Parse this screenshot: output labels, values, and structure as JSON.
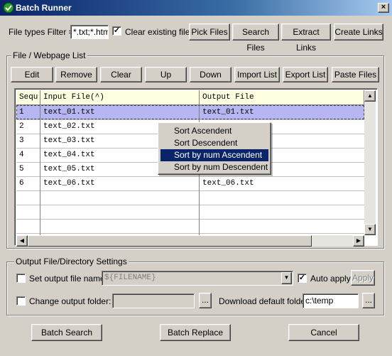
{
  "window": {
    "title": "Batch Runner"
  },
  "toolbar": {
    "filter_label": "File types Filter =>",
    "filter_value": "*.txt;*.html",
    "clear_label": "Clear existing files",
    "clear_checked": "✓",
    "pick_files": "Pick Files",
    "search_files": "Search Files",
    "extract_links": "Extract Links",
    "create_links": "Create Links"
  },
  "list_group": {
    "title": "File / Webpage List",
    "buttons": {
      "edit": "Edit",
      "remove": "Remove",
      "clear": "Clear",
      "up": "Up",
      "down": "Down",
      "import": "Import List",
      "export": "Export List",
      "paste": "Paste Files"
    },
    "columns": [
      "Sequ",
      "Input File(^)",
      "Output File"
    ],
    "rows": [
      {
        "seq": "1",
        "input": "text_01.txt",
        "output": "text_01.txt"
      },
      {
        "seq": "2",
        "input": "text_02.txt",
        "output": ""
      },
      {
        "seq": "3",
        "input": "text_03.txt",
        "output": ""
      },
      {
        "seq": "4",
        "input": "text_04.txt",
        "output": ""
      },
      {
        "seq": "5",
        "input": "text_05.txt",
        "output": ""
      },
      {
        "seq": "6",
        "input": "text_06.txt",
        "output": "text_06.txt"
      }
    ]
  },
  "context_menu": {
    "items": [
      "Sort Ascendent",
      "Sort Descendent",
      "Sort by num Ascendent",
      "Sort by num Descendent"
    ],
    "selected_index": 2
  },
  "output_group": {
    "title": "Output File/Directory Settings",
    "set_output_label": "Set output file name:",
    "output_name_value": "${FILENAME}",
    "auto_apply_label": "Auto apply",
    "auto_apply_checked": "✓",
    "apply": "Apply",
    "change_folder_label": "Change output folder:",
    "browse": "...",
    "download_label": "Download default folder:",
    "download_value": "c:\\temp"
  },
  "footer": {
    "batch_search": "Batch Search",
    "batch_replace": "Batch Replace",
    "cancel": "Cancel"
  }
}
